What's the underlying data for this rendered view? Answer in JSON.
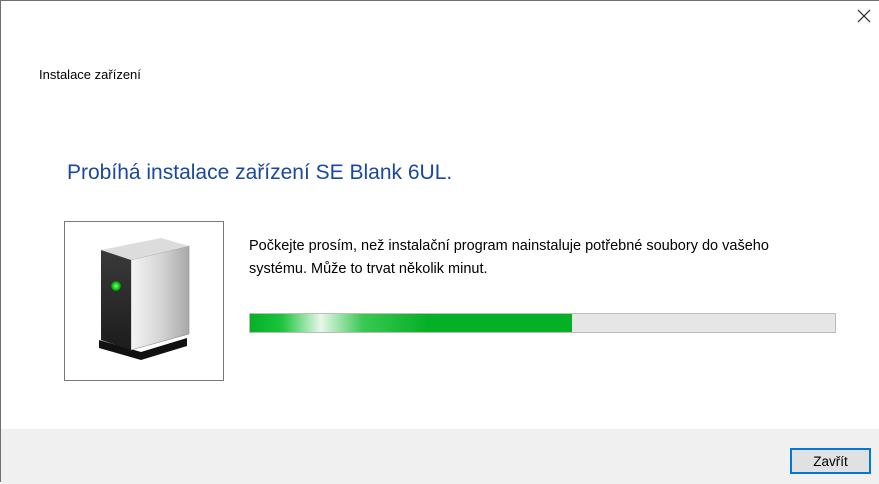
{
  "window": {
    "title": "Instalace zařízení",
    "close_icon": "close-icon"
  },
  "main": {
    "heading": "Probíhá instalace zařízení SE Blank 6UL.",
    "device_icon": "device-drive-icon",
    "message": "Počkejte prosím, než instalační program nainstaluje potřebné soubory do vašeho systému. Může to trvat několik minut.",
    "progress_fraction": 0.55
  },
  "footer": {
    "close_label": "Zavřít"
  },
  "colors": {
    "heading": "#1a48a0",
    "progress_fill": "#06b025",
    "progress_track": "#e6e6e6",
    "footer_bg": "#f0f0f0",
    "button_border": "#0078d7"
  }
}
